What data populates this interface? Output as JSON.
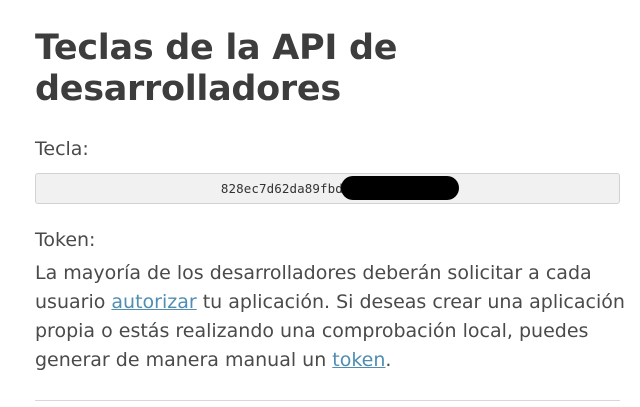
{
  "title": "Teclas de la API de desarrolladores",
  "key_section": {
    "label": "Tecla:",
    "value": "828ec7d62da89fbdfa"
  },
  "token_section": {
    "label": "Token:",
    "text_part1": "La mayoría de los desarrolladores deberán solicitar a cada usuario ",
    "link_authorize": "autorizar",
    "text_part2": " tu aplicación. Si deseas crear una aplicación propia o estás realizando una comprobación local, puedes generar de manera manual un ",
    "link_token": "token",
    "text_part3": "."
  }
}
